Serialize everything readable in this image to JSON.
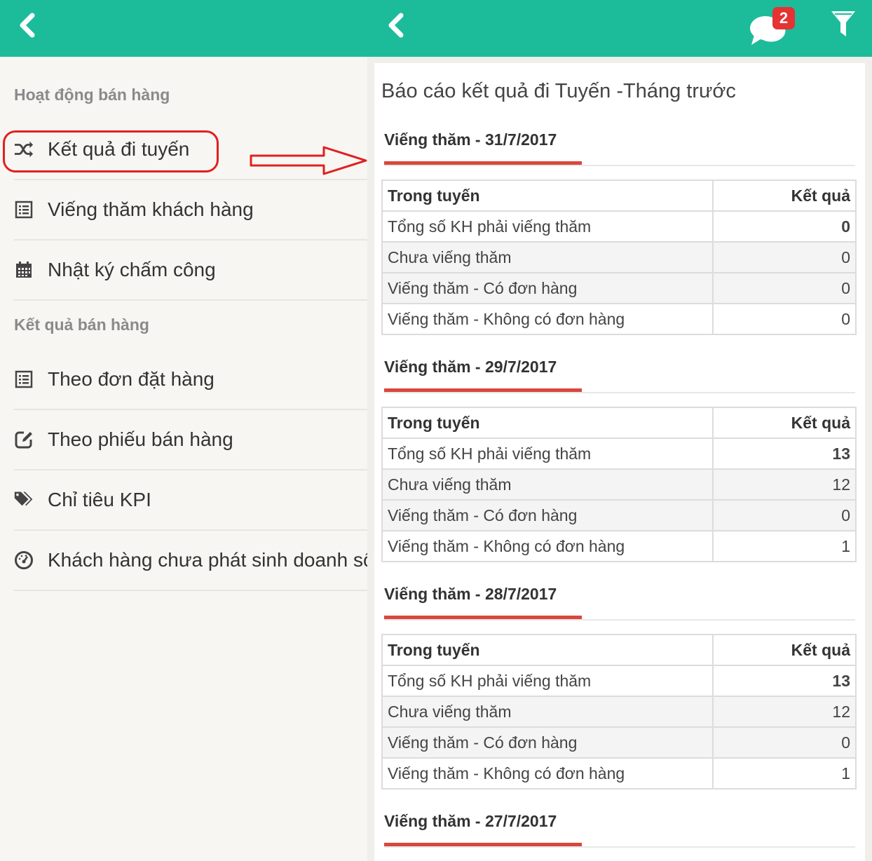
{
  "left": {
    "sections": [
      {
        "title": "Hoạt động bán hàng",
        "items": [
          {
            "label": "Kết quả đi tuyến",
            "icon": "shuffle-icon"
          },
          {
            "label": "Viếng thăm khách hàng",
            "icon": "list-icon"
          },
          {
            "label": "Nhật ký chấm công",
            "icon": "calendar-icon"
          }
        ]
      },
      {
        "title": "Kết quả bán hàng",
        "items": [
          {
            "label": "Theo đơn đặt hàng",
            "icon": "list-icon"
          },
          {
            "label": "Theo phiếu bán hàng",
            "icon": "edit-icon"
          },
          {
            "label": "Chỉ tiêu KPI",
            "icon": "tags-icon"
          },
          {
            "label": "Khách hàng chưa phát sinh doanh số",
            "icon": "dashboard-icon"
          }
        ]
      }
    ]
  },
  "right": {
    "notification_count": "2",
    "page_title": "Báo cáo kết quả đi Tuyến -Tháng trước",
    "visits": [
      {
        "title": "Viếng thăm - 31/7/2017",
        "header": [
          "Trong tuyến",
          "Kết quả"
        ],
        "rows": [
          [
            "Tổng số KH phải viếng thăm",
            "0"
          ],
          [
            "Chưa viếng thăm",
            "0"
          ],
          [
            "Viếng thăm - Có đơn hàng",
            "0"
          ],
          [
            "Viếng thăm - Không có đơn hàng",
            "0"
          ]
        ]
      },
      {
        "title": "Viếng thăm - 29/7/2017",
        "header": [
          "Trong tuyến",
          "Kết quả"
        ],
        "rows": [
          [
            "Tổng số KH phải viếng thăm",
            "13"
          ],
          [
            "Chưa viếng thăm",
            "12"
          ],
          [
            "Viếng thăm - Có đơn hàng",
            "0"
          ],
          [
            "Viếng thăm - Không có đơn hàng",
            "1"
          ]
        ]
      },
      {
        "title": "Viếng thăm - 28/7/2017",
        "header": [
          "Trong tuyến",
          "Kết quả"
        ],
        "rows": [
          [
            "Tổng số KH phải viếng thăm",
            "13"
          ],
          [
            "Chưa viếng thăm",
            "12"
          ],
          [
            "Viếng thăm - Có đơn hàng",
            "0"
          ],
          [
            "Viếng thăm - Không có đơn hàng",
            "1"
          ]
        ]
      },
      {
        "title": "Viếng thăm - 27/7/2017"
      }
    ]
  },
  "colors": {
    "header_bar": "#1cbc9b",
    "accent_underline": "#d9473b",
    "badge": "#e53232",
    "annotation": "#e02020"
  }
}
